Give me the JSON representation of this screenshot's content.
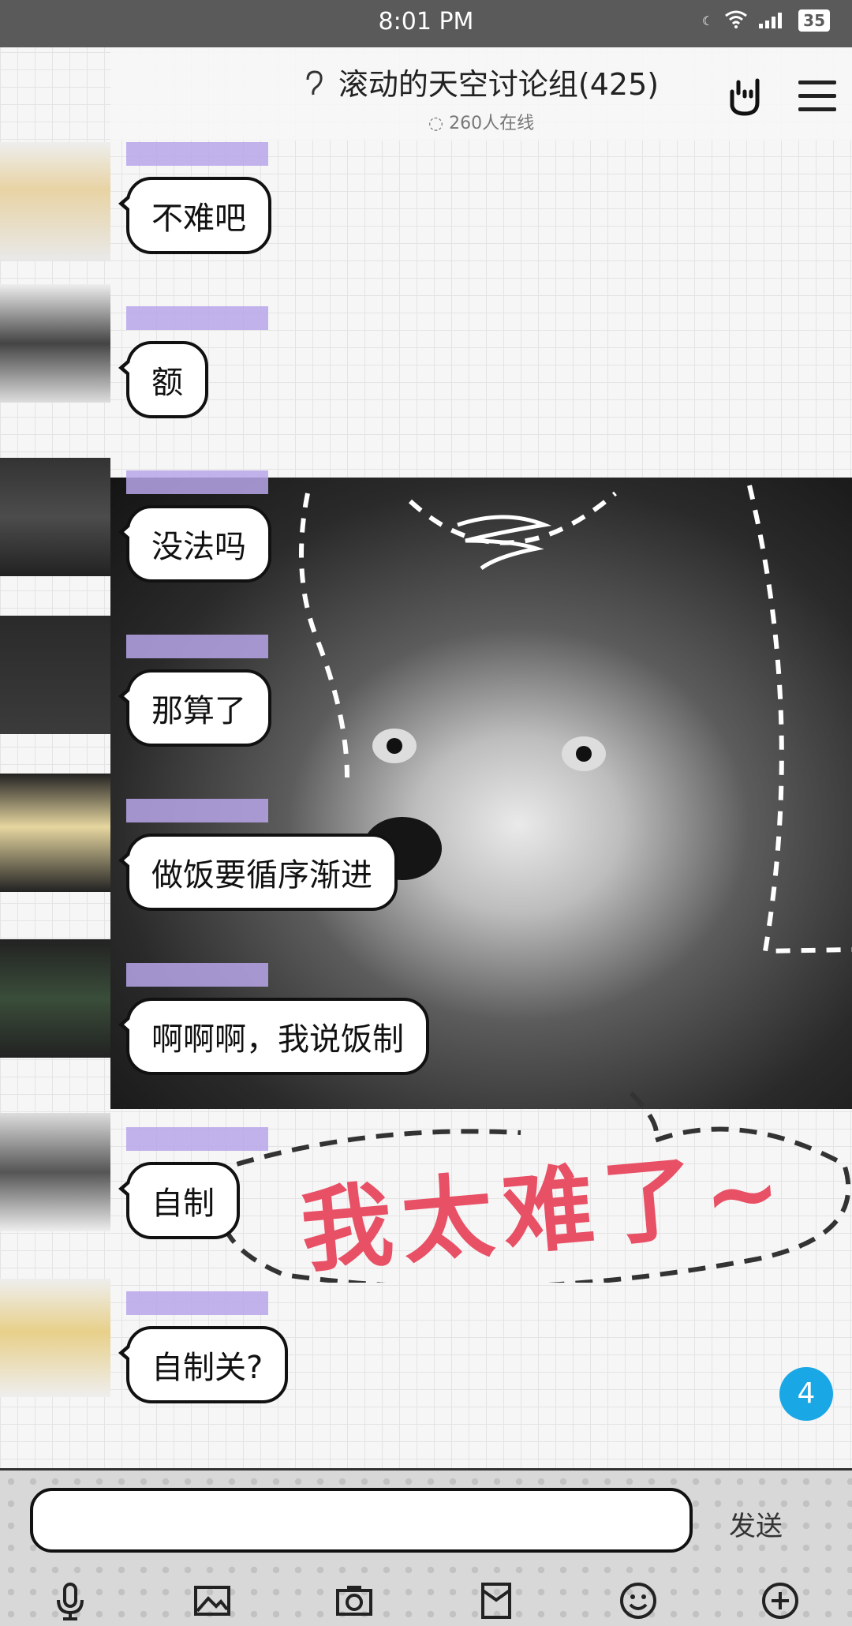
{
  "status_bar": {
    "time": "8:01 PM",
    "battery": "35"
  },
  "header": {
    "title": "滚动的天空讨论组(425)",
    "online": "260人在线"
  },
  "messages": [
    {
      "text": "不难吧"
    },
    {
      "text": "额"
    },
    {
      "text": "没法吗"
    },
    {
      "text": "那算了"
    },
    {
      "text": "做饭要循序渐进"
    },
    {
      "text": "啊啊啊，我说饭制"
    },
    {
      "text": "自制"
    },
    {
      "text": "自制关?"
    }
  ],
  "sticker": {
    "caption": "我太难了~"
  },
  "unread_count": "4",
  "input": {
    "value": "",
    "send_label": "发送"
  },
  "toolbar": [
    "mic-icon",
    "image-icon",
    "camera-icon",
    "red-envelope-icon",
    "emoji-icon",
    "plus-icon"
  ],
  "colors": {
    "accent": "#19a7e6",
    "caption": "#e85065",
    "sender_placeholder": "#b9a6ea"
  }
}
